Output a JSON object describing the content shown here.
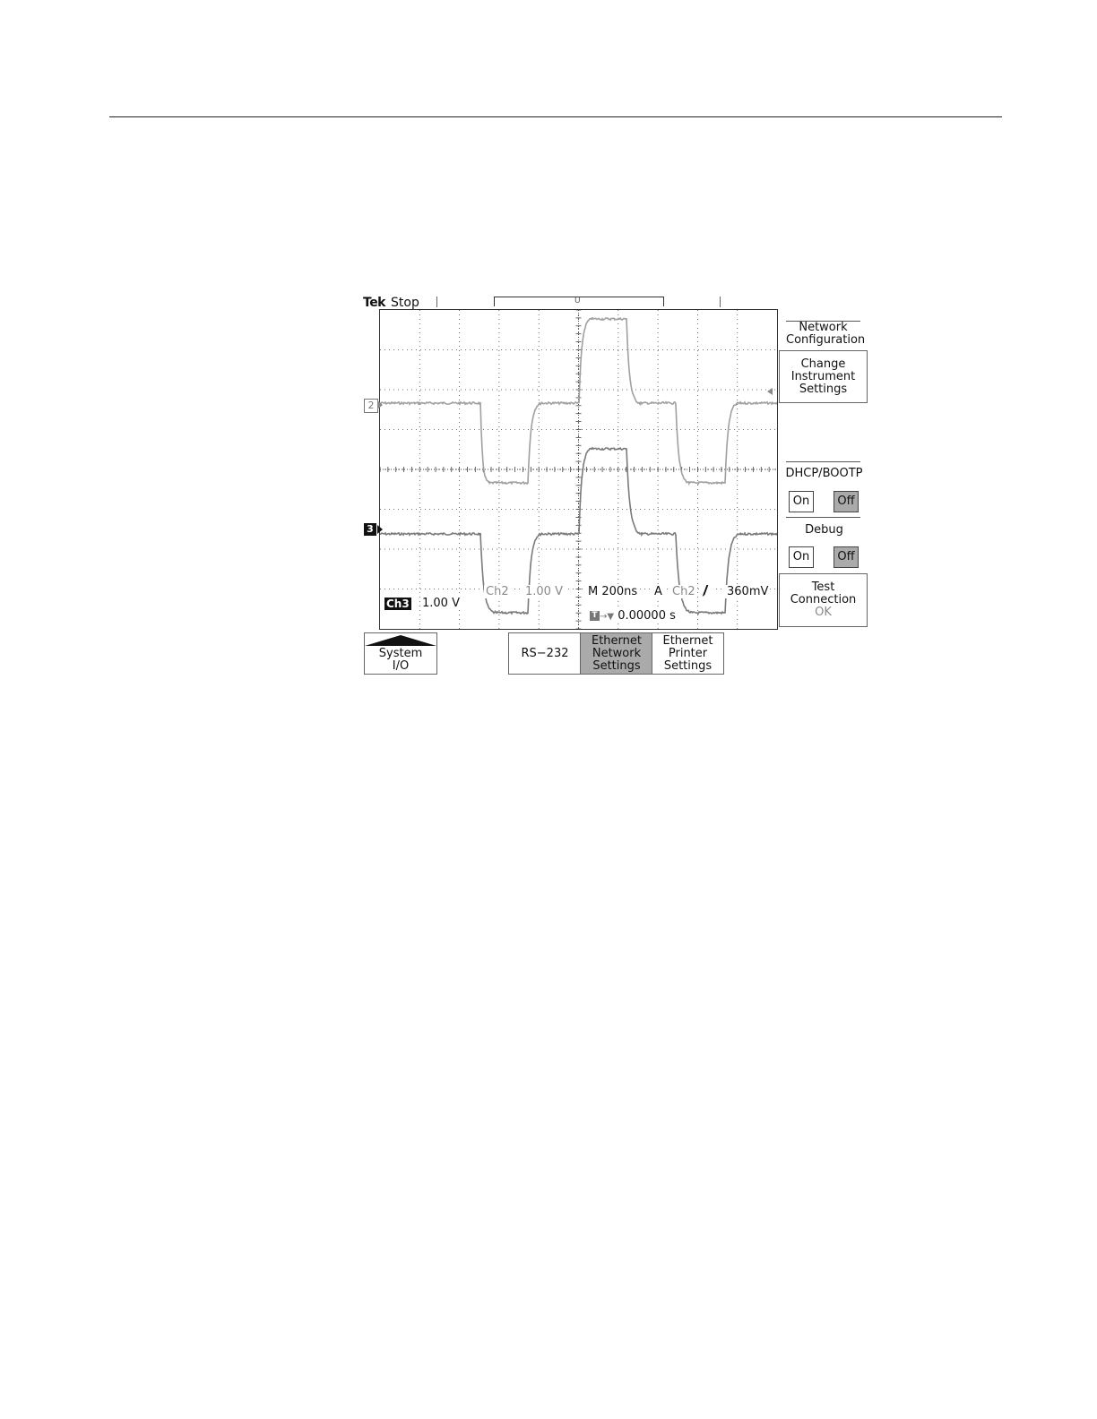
{
  "scope": {
    "brand": "Tek",
    "state": "Stop",
    "record_marker": "U",
    "trigger_position_label": "T",
    "channel_markers": {
      "ch2": "2",
      "ch3": "3"
    }
  },
  "readouts": {
    "ch3_label": "Ch3",
    "ch3_scale": "1.00 V",
    "ch2_label": "Ch2",
    "ch2_scale": "1.00 V",
    "timebase": "M 200ns",
    "trigger_mode": "A",
    "trigger_source": "Ch2",
    "trigger_level": "360mV",
    "trigger_time_icon": "T",
    "trigger_time_arrows": "→▼",
    "trigger_time": "0.00000 s"
  },
  "side_menu": {
    "title_line1": "Network",
    "title_line2": "Configuration",
    "change_line1": "Change",
    "change_line2": "Instrument",
    "change_line3": "Settings",
    "dhcp_label": "DHCP/BOOTP",
    "dhcp_on": "On",
    "dhcp_off": "Off",
    "dhcp_selected": "Off",
    "debug_label": "Debug",
    "debug_on": "On",
    "debug_off": "Off",
    "debug_selected": "Off",
    "test_line1": "Test",
    "test_line2": "Connection",
    "test_status": "OK"
  },
  "bottom_menu": {
    "system_line1": "System",
    "system_line2": "I/O",
    "rs232": "RS−232",
    "eth_net_line1": "Ethernet",
    "eth_net_line2": "Network",
    "eth_net_line3": "Settings",
    "eth_prn_line1": "Ethernet",
    "eth_prn_line2": "Printer",
    "eth_prn_line3": "Settings",
    "selected": "Ethernet Network Settings"
  },
  "colors": {
    "trace_ch2": "#a0a0a0",
    "trace_ch3": "#7a7a7a",
    "grid": "#444444",
    "selected_button": "#aaaaaa"
  }
}
